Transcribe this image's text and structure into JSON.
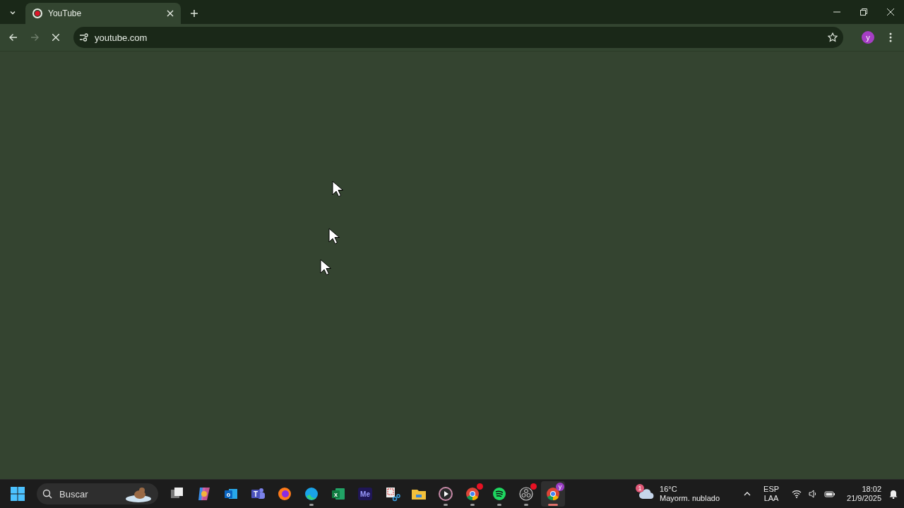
{
  "browser": {
    "tabs": [
      {
        "title": "YouTube",
        "selected": true
      }
    ],
    "loading": true,
    "forward_enabled": false,
    "url": "youtube.com",
    "profile_initial": "y"
  },
  "taskbar": {
    "search": {
      "placeholder": "Buscar"
    },
    "apps": [
      {
        "kind": "taskview",
        "running": false,
        "active": false
      },
      {
        "kind": "copilot",
        "running": false,
        "active": false
      },
      {
        "kind": "outlook",
        "label": "o",
        "running": false,
        "active": false
      },
      {
        "kind": "teams",
        "label": "T",
        "running": false,
        "active": false
      },
      {
        "kind": "firefox",
        "running": false,
        "active": false
      },
      {
        "kind": "edge",
        "running": true,
        "active": false
      },
      {
        "kind": "excel",
        "label": "x",
        "running": false,
        "active": false
      },
      {
        "kind": "encoder",
        "label": "Me",
        "running": false,
        "active": false
      },
      {
        "kind": "snip",
        "running": false,
        "active": false
      },
      {
        "kind": "folder",
        "running": false,
        "active": false
      },
      {
        "kind": "player",
        "running": true,
        "active": false
      },
      {
        "kind": "chrome",
        "running": true,
        "active": false,
        "notification": true
      },
      {
        "kind": "spotify",
        "running": true,
        "active": false
      },
      {
        "kind": "obs",
        "running": true,
        "active": false,
        "notification": true
      },
      {
        "kind": "chrome",
        "running": true,
        "active": true,
        "profile": "y"
      }
    ],
    "weather": {
      "alerts": "1",
      "temperature": "16°C",
      "condition": "Mayorm. nublado"
    },
    "language": [
      "ESP",
      "LAA"
    ],
    "time": "18:02",
    "date": "21/9/2025"
  }
}
